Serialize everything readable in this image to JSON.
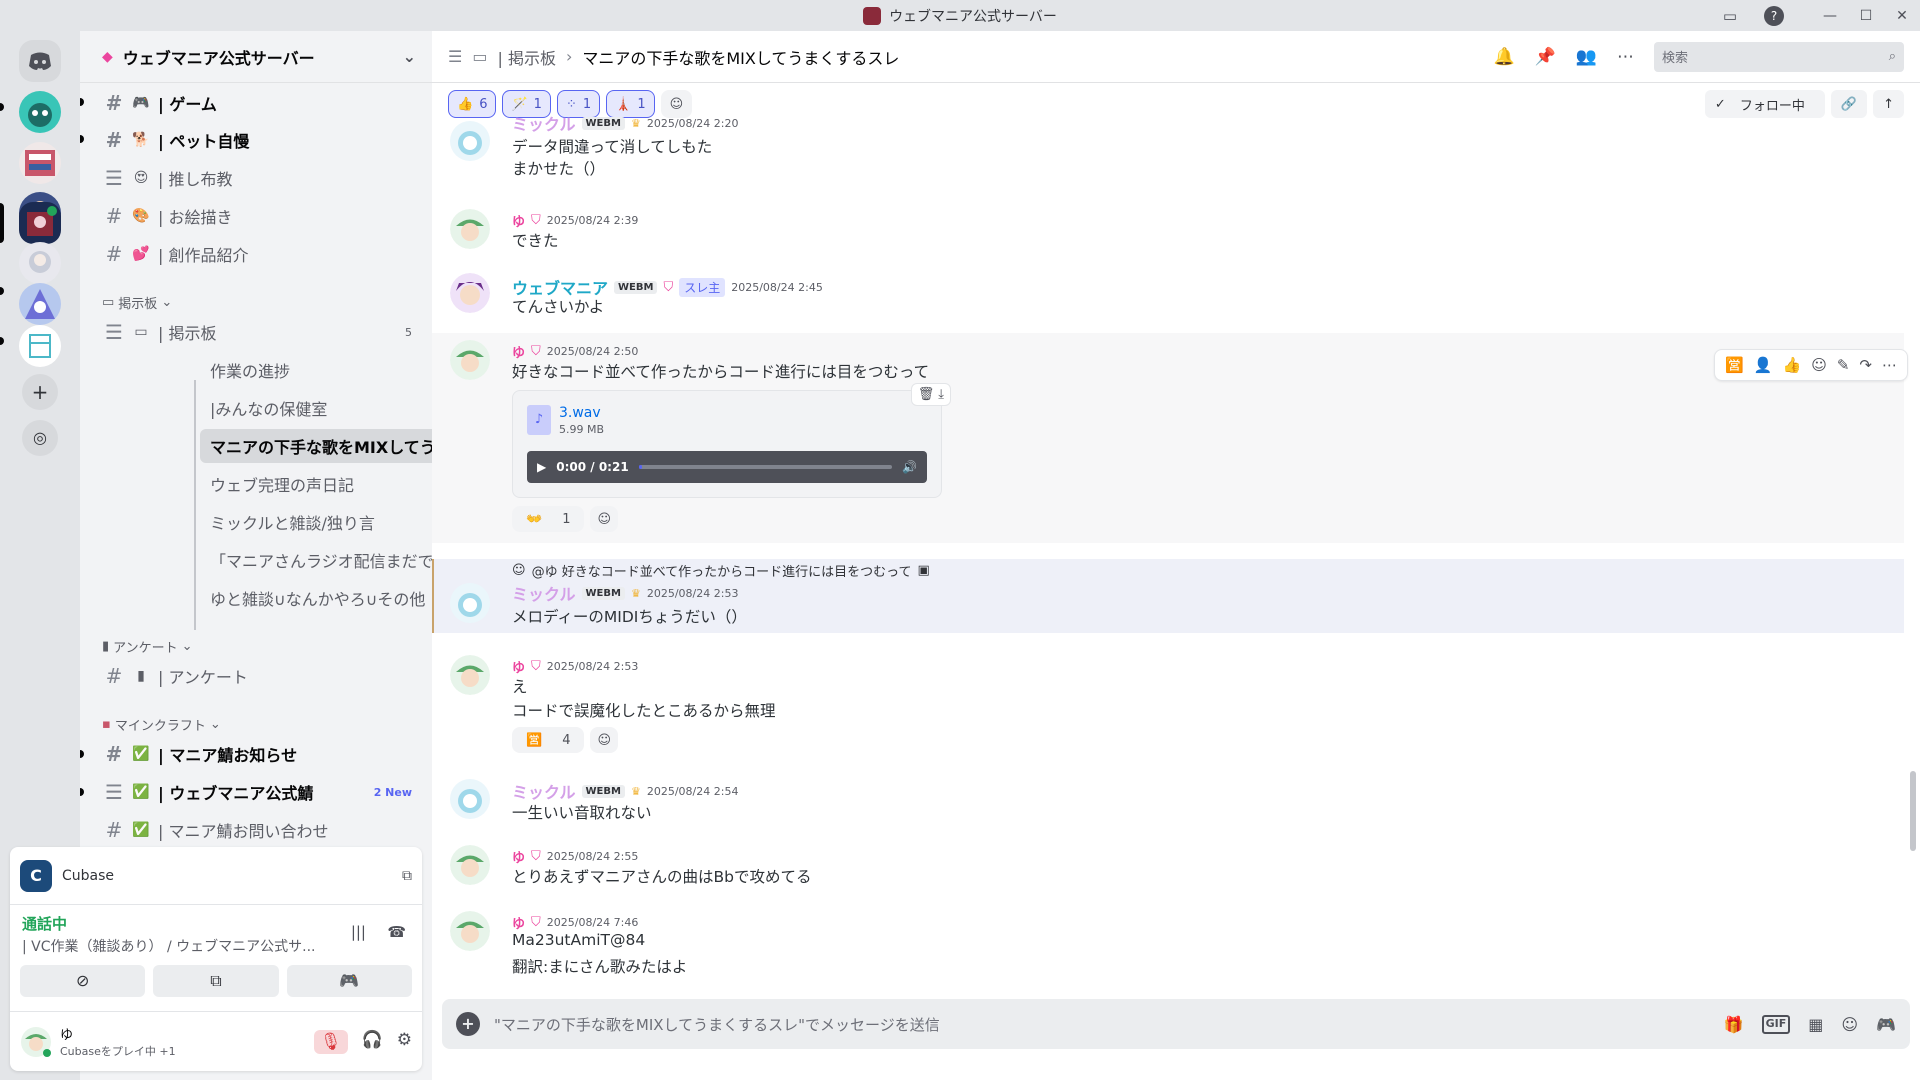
{
  "window": {
    "title": "ウェブマニア公式サーバー",
    "buttons": [
      "—",
      "☐",
      "✕"
    ]
  },
  "sidebar": {
    "guild_name": "ウェブマニア公式サーバー",
    "channels_top": [
      {
        "label": "| ゲーム",
        "emoji": "🎮",
        "bold": true
      },
      {
        "label": "| ペット自慢",
        "emoji": "🐕",
        "bold": true
      },
      {
        "label": "| 推し布教",
        "emoji": "😍",
        "bold": false
      },
      {
        "label": "| お絵描き",
        "emoji": "🎨",
        "bold": false
      },
      {
        "label": "| 創作品紹介",
        "emoji": "💕",
        "bold": false
      }
    ],
    "category_board": "掲示板",
    "board_channel": {
      "label": "| 掲示板",
      "count": "5"
    },
    "threads": [
      "作業の進捗",
      "|みんなの保健室",
      "マニアの下手な歌をMIXしてうまくす...",
      "ウェブ完理の声日記",
      "ミックルと雑談/独り言",
      "「マニアさんラジオ配信まだですか...",
      "ゆと雑談∪なんかやろ∪その他"
    ],
    "category_survey": "アンケート",
    "survey_channel": "| アンケート",
    "category_minecraft": "マインクラフト",
    "mc_channels": [
      {
        "label": "| マニア鯖お知らせ",
        "bold": true,
        "tag": ""
      },
      {
        "label": "| ウェブマニア公式鯖",
        "bold": true,
        "tag": "2 New"
      },
      {
        "label": "| マニア鯖お問い合わせ",
        "bold": false,
        "tag": ""
      }
    ]
  },
  "voice_panel": {
    "activity": "Cubase",
    "status": "通話中",
    "location": "| VC作業（雑談あり） / ウェブマニア公式サ...",
    "user_name": "ゆ",
    "user_activity": "Cubaseをプレイ中 +1"
  },
  "header": {
    "crumb": "| 掲示板",
    "thread_title": "マニアの下手な歌をMIXしてうまくするスレ",
    "search_placeholder": "検索"
  },
  "thread_reactions": [
    {
      "emoji": "👍",
      "count": "6"
    },
    {
      "emoji": "🪄",
      "count": "1"
    },
    {
      "emoji": "⁘",
      "count": "1"
    },
    {
      "emoji": "🗼",
      "count": "1"
    }
  ],
  "follow_label": "フォロー中",
  "messages": [
    {
      "name": "ミックル",
      "badge": "WEBM",
      "time": "2025/08/24 2:20",
      "lines": [
        "データ間違って消してしもた",
        "まかせた（）"
      ]
    },
    {
      "name": "ゆ",
      "time": "2025/08/24 2:39",
      "lines": [
        "できた"
      ]
    },
    {
      "name": "ウェブマニア",
      "badge": "WEBM",
      "role": "スレ主",
      "time": "2025/08/24 2:45",
      "lines": [
        "てんさいかよ"
      ]
    },
    {
      "name": "ゆ",
      "time": "2025/08/24 2:50",
      "lines": [
        "好きなコード並べて作ったからコード進行には目をつむって"
      ],
      "attachment": {
        "file": "3.wav",
        "size": "5.99 MB",
        "time": "0:00 / 0:21",
        "progress": 0.01
      },
      "reaction": {
        "emoji": "👐",
        "count": "1"
      }
    },
    {
      "reply_to": "@ゆ 好きなコード並べて作ったからコード進行には目をつむって",
      "name": "ミックル",
      "badge": "WEBM",
      "time": "2025/08/24 2:53",
      "lines": [
        "メロディーのMIDIちょうだい（）"
      ]
    },
    {
      "name": "ゆ",
      "time": "2025/08/24 2:53",
      "lines": [
        "え",
        "コードで誤魔化したとこあるから無理"
      ],
      "reaction": {
        "emoji": "🈺",
        "count": "4"
      }
    },
    {
      "name": "ミックル",
      "badge": "WEBM",
      "time": "2025/08/24 2:54",
      "lines": [
        "一生いい音取れない"
      ]
    },
    {
      "name": "ゆ",
      "time": "2025/08/24 2:55",
      "lines": [
        "とりあえずマニアさんの曲はBbで攻めてる"
      ]
    },
    {
      "name": "ゆ",
      "time": "2025/08/24 7:46",
      "lines": [
        "Ma23utAmiT@84",
        "翻訳:まにさん歌みたはよ"
      ]
    }
  ],
  "composer": {
    "placeholder": "\"マニアの下手な歌をMIXしてうまくするスレ\"でメッセージを送信",
    "gif_label": "GIF"
  },
  "colors": {
    "accent": "#5865f2",
    "name_mikkuru": "#d4a0e8",
    "name_webmania": "#1fa8c7",
    "name_yu": "#eb459e",
    "online": "#23a55a"
  }
}
